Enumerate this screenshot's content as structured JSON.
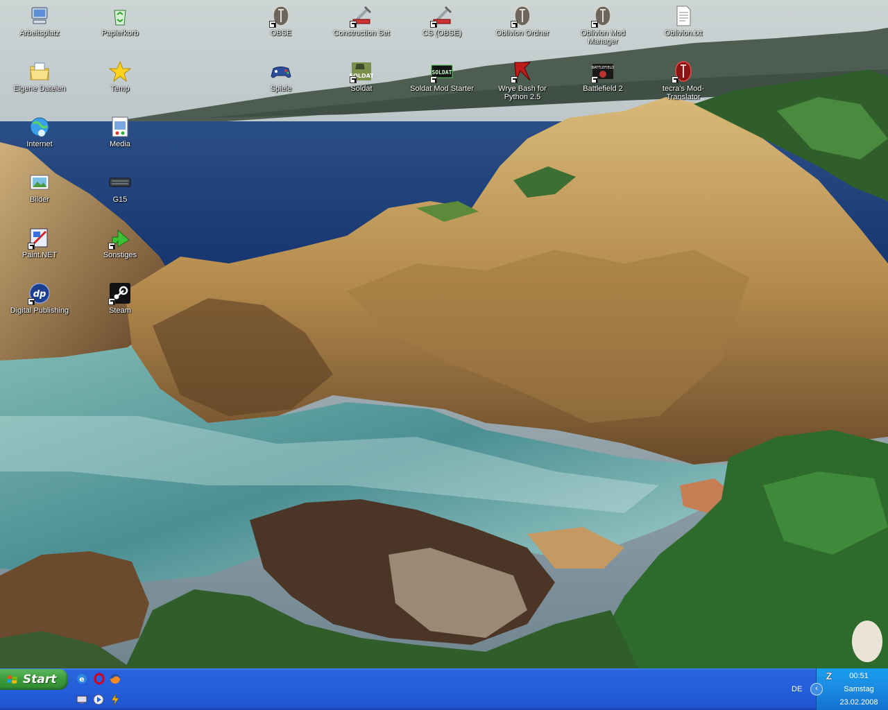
{
  "desktop": {
    "icons": [
      {
        "label": "Arbeitsplatz",
        "icon": "computer-icon"
      },
      {
        "label": "Papierkorb",
        "icon": "recycle-bin-icon"
      },
      {
        "label": "OBSE",
        "icon": "oblivion-seal-icon"
      },
      {
        "label": "Construction Set",
        "icon": "construction-set-icon"
      },
      {
        "label": "CS (OBSE)",
        "icon": "construction-set-icon"
      },
      {
        "label": "Oblivion Ordner",
        "icon": "oblivion-seal-icon"
      },
      {
        "label": "Oblivion Mod Manager",
        "icon": "oblivion-seal-icon"
      },
      {
        "label": "Oblivion.txt",
        "icon": "text-file-icon"
      },
      {
        "label": "Eigene Dateien",
        "icon": "folder-icon"
      },
      {
        "label": "Temp",
        "icon": "star-icon"
      },
      {
        "label": "Spiele",
        "icon": "gamepad-icon"
      },
      {
        "label": "Soldat",
        "icon": "soldat-icon"
      },
      {
        "label": "Soldat Mod Starter",
        "icon": "soldat-mod-starter-icon"
      },
      {
        "label": "Wrye Bash for Python 2.5",
        "icon": "wrye-bash-icon"
      },
      {
        "label": "Battlefield 2",
        "icon": "battlefield-icon"
      },
      {
        "label": "tecra's Mod-Translator",
        "icon": "oblivion-red-seal-icon"
      },
      {
        "label": "Internet",
        "icon": "internet-icon"
      },
      {
        "label": "Media",
        "icon": "media-icon"
      },
      {
        "label": "Bilder",
        "icon": "pictures-icon"
      },
      {
        "label": "G15",
        "icon": "keyboard-icon"
      },
      {
        "label": "Paint.NET",
        "icon": "paint-net-icon"
      },
      {
        "label": "Sonstiges",
        "icon": "green-arrow-icon"
      },
      {
        "label": "Digital Publishing",
        "icon": "digital-publishing-icon"
      },
      {
        "label": "Steam",
        "icon": "steam-icon"
      }
    ]
  },
  "taskbar": {
    "start_label": "Start",
    "quick_launch": [
      {
        "name": "internet-explorer-icon"
      },
      {
        "name": "opera-icon"
      },
      {
        "name": "firefox-icon"
      },
      {
        "name": "network-icon"
      },
      {
        "name": "media-player-icon"
      },
      {
        "name": "winamp-icon"
      }
    ],
    "language": "DE",
    "tray_toggle": "‹",
    "clock": {
      "time": "00:51",
      "day": "Samstag",
      "date": "23.02.2008"
    }
  },
  "colors": {
    "taskbar": "#245edb",
    "start": "#3d9e3d",
    "tray": "#1b8ae0"
  }
}
